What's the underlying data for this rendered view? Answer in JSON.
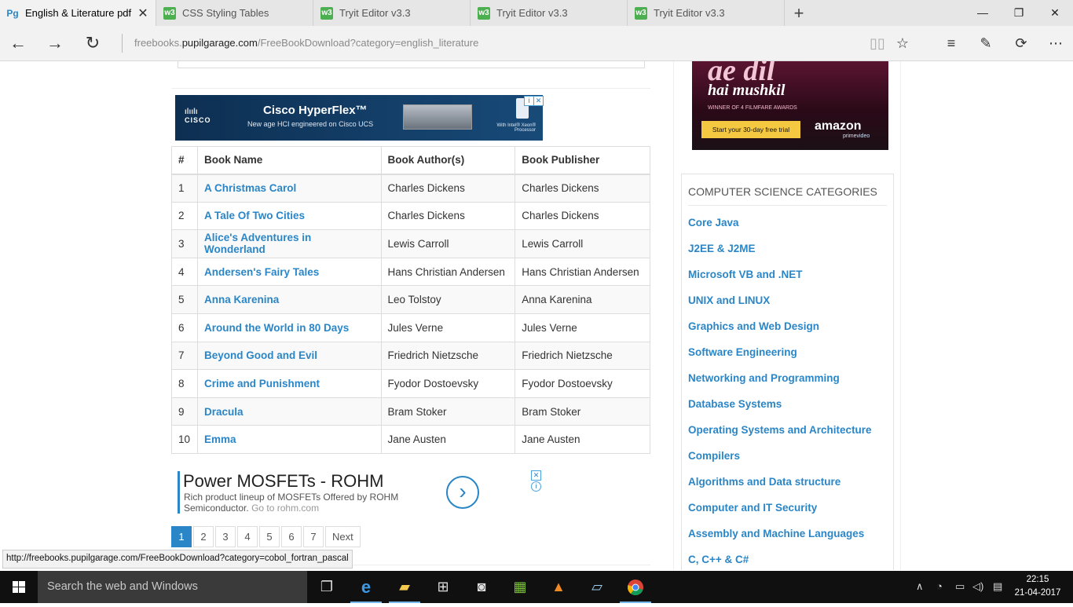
{
  "browser": {
    "tabs": [
      {
        "title": "English & Literature pdf",
        "favicon": "pg-icon",
        "active": true
      },
      {
        "title": "CSS Styling Tables",
        "favicon": "w3-icon",
        "active": false
      },
      {
        "title": "Tryit Editor v3.3",
        "favicon": "w3-icon",
        "active": false
      },
      {
        "title": "Tryit Editor v3.3",
        "favicon": "w3-icon",
        "active": false
      },
      {
        "title": "Tryit Editor v3.3",
        "favicon": "w3-icon",
        "active": false
      }
    ],
    "url_prefix": "freebooks.",
    "url_domain": "pupilgarage.com",
    "url_path": "/FreeBookDownload?category=english_literature",
    "status_url": "http://freebooks.pupilgarage.com/FreeBookDownload?category=cobol_fortran_pascal"
  },
  "ads": {
    "cisco_brand": "CISCO",
    "cisco_title": "Cisco HyperFlex™",
    "cisco_subtitle": "New age HCI engineered on Cisco UCS",
    "cisco_intel": "With Intel® Xeon® Processor",
    "rohm_title": "Power MOSFETs - ROHM",
    "rohm_text": "Rich product lineup of MOSFETs Offered by ROHM Semiconductor.",
    "rohm_link": "Go to rohm.com",
    "movie_title1": "ae dil",
    "movie_title2": "hai mushkil",
    "movie_awards": "WINNER OF 4 FILMFARE AWARDS",
    "movie_cta": "Start your 30-day free trial",
    "amazon": "amazon",
    "prime": "primevideo"
  },
  "table": {
    "headers": [
      "#",
      "Book Name",
      "Book Author(s)",
      "Book Publisher"
    ],
    "rows": [
      {
        "num": "1",
        "name": "A Christmas Carol",
        "author": "Charles Dickens",
        "publisher": "Charles Dickens"
      },
      {
        "num": "2",
        "name": "A Tale Of Two Cities",
        "author": "Charles Dickens",
        "publisher": "Charles Dickens"
      },
      {
        "num": "3",
        "name": "Alice's Adventures in Wonderland",
        "author": "Lewis Carroll",
        "publisher": "Lewis Carroll"
      },
      {
        "num": "4",
        "name": "Andersen's Fairy Tales",
        "author": "Hans Christian Andersen",
        "publisher": "Hans Christian Andersen"
      },
      {
        "num": "5",
        "name": "Anna Karenina",
        "author": "Leo Tolstoy",
        "publisher": "Anna Karenina"
      },
      {
        "num": "6",
        "name": "Around the World in 80 Days",
        "author": "Jules Verne",
        "publisher": "Jules Verne"
      },
      {
        "num": "7",
        "name": "Beyond Good and Evil",
        "author": "Friedrich Nietzsche",
        "publisher": "Friedrich Nietzsche"
      },
      {
        "num": "8",
        "name": "Crime and Punishment",
        "author": "Fyodor Dostoevsky",
        "publisher": "Fyodor Dostoevsky"
      },
      {
        "num": "9",
        "name": "Dracula",
        "author": "Bram Stoker",
        "publisher": "Bram Stoker"
      },
      {
        "num": "10",
        "name": "Emma",
        "author": "Jane Austen",
        "publisher": "Jane Austen"
      }
    ]
  },
  "pagination": {
    "pages": [
      "1",
      "2",
      "3",
      "4",
      "5",
      "6",
      "7"
    ],
    "current": "1",
    "next_label": "Next"
  },
  "sidebar": {
    "title": "COMPUTER SCIENCE CATEGORIES",
    "categories": [
      "Core Java",
      "J2EE & J2ME",
      "Microsoft VB and .NET",
      "UNIX and LINUX",
      "Graphics and Web Design",
      "Software Engineering",
      "Networking and Programming",
      "Database Systems",
      "Operating Systems and Architecture",
      "Compilers",
      "Algorithms and Data structure",
      "Computer and IT Security",
      "Assembly and Machine Languages",
      "C, C++ & C#"
    ]
  },
  "taskbar": {
    "search_placeholder": "Search the web and Windows",
    "time": "22:15",
    "date": "21-04-2017"
  },
  "colors": {
    "link": "#2a86c7",
    "taskbar": "#101010"
  }
}
